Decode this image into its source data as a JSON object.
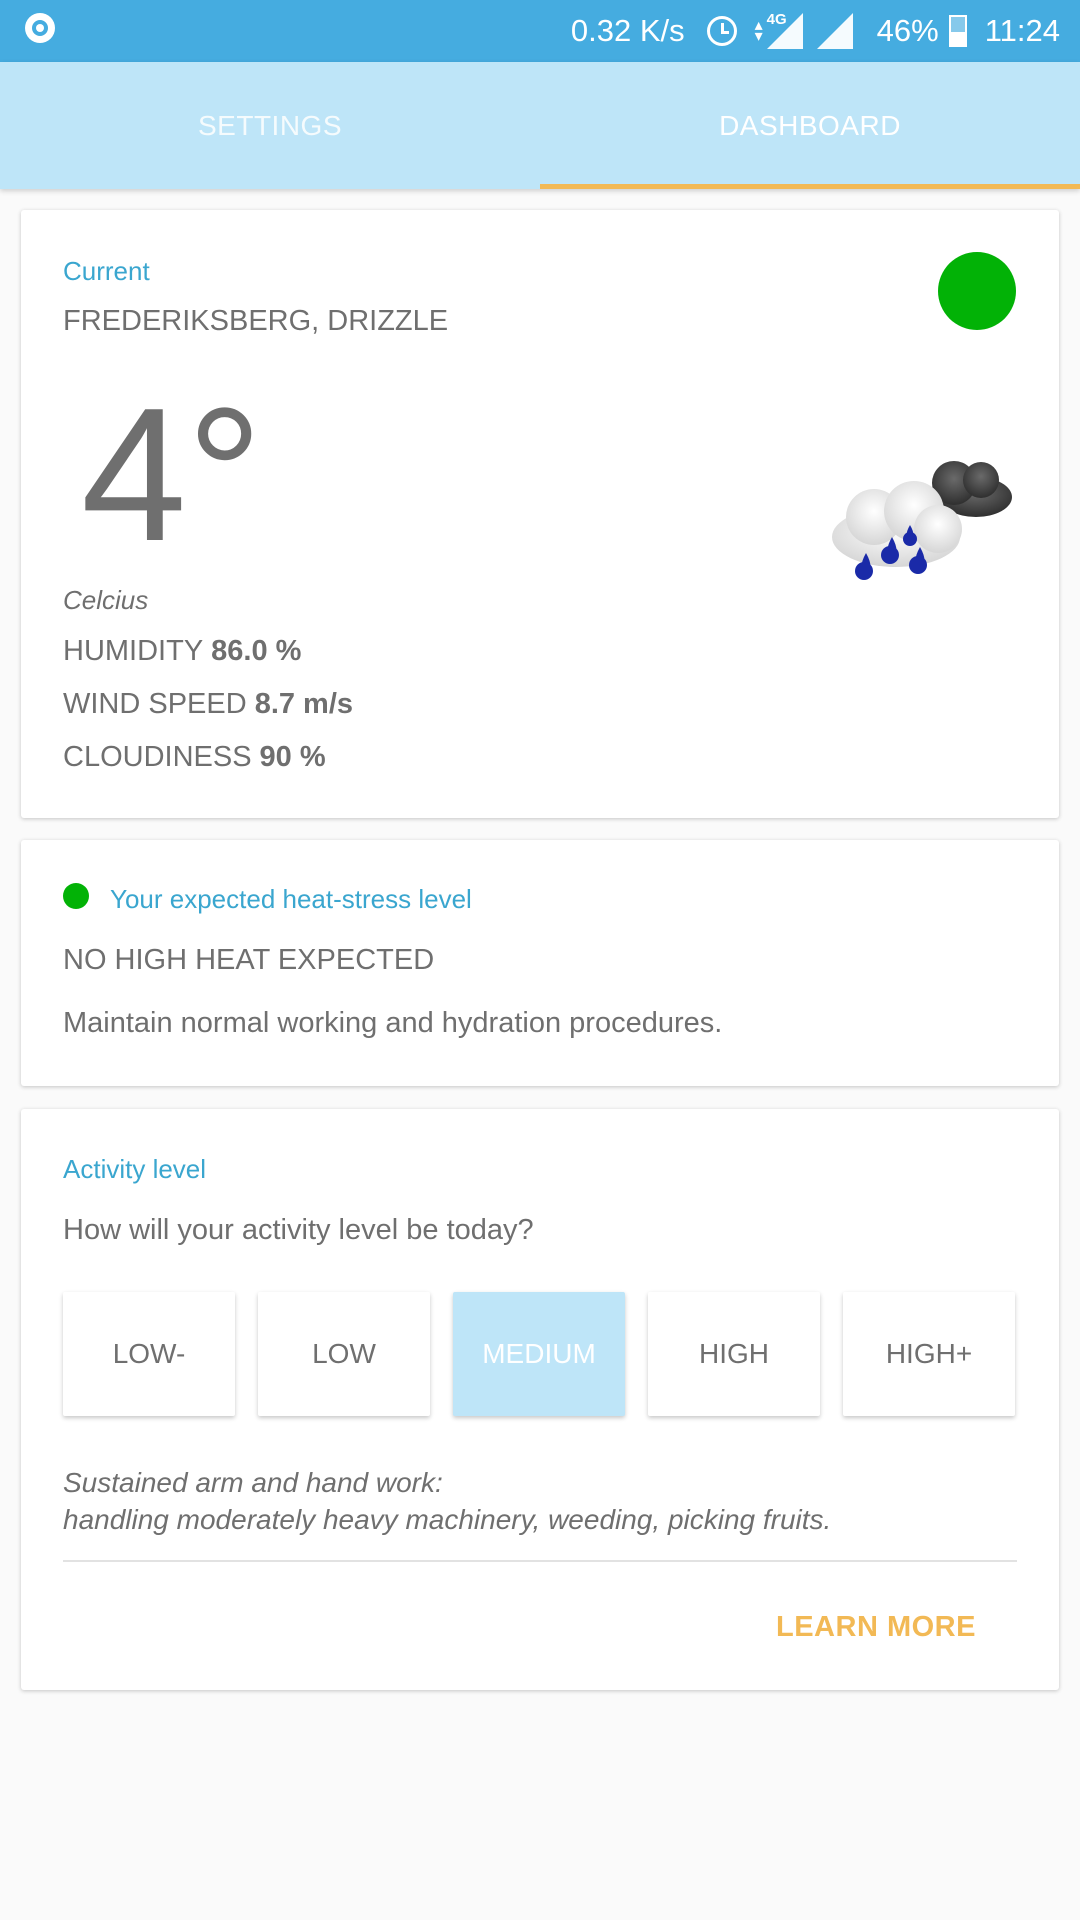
{
  "status_bar": {
    "speed": "0.32 K/s",
    "network_type": "4G",
    "battery": "46%",
    "time": "11:24",
    "icons": [
      "app-notification-icon",
      "alarm-icon",
      "data-arrows-icon",
      "signal-icon",
      "battery-charging-icon"
    ]
  },
  "tabs": [
    {
      "label": "SETTINGS",
      "selected": false
    },
    {
      "label": "DASHBOARD",
      "selected": true
    }
  ],
  "weather": {
    "label": "Current",
    "location": "FREDERIKSBERG, DRIZZLE",
    "temperature": "4°",
    "unit": "Celcius",
    "status_color": "#02b206",
    "icon": "drizzle-cloud-icon",
    "metrics": [
      {
        "label": "HUMIDITY",
        "value": "86.0 %"
      },
      {
        "label": "WIND SPEED",
        "value": "8.7 m/s"
      },
      {
        "label": "CLOUDINESS",
        "value": "90 %"
      }
    ]
  },
  "heat_stress": {
    "label": "Your expected heat-stress level",
    "level": "NO HIGH HEAT EXPECTED",
    "advice": "Maintain normal working and hydration procedures.",
    "indicator_color": "#02b206"
  },
  "activity": {
    "label": "Activity level",
    "question": "How will your activity level be today?",
    "levels": [
      "LOW-",
      "LOW",
      "MEDIUM",
      "HIGH",
      "HIGH+"
    ],
    "selected": "MEDIUM",
    "description_line1": "Sustained arm and hand work:",
    "description_line2": "handling moderately heavy machinery, weeding, picking fruits.",
    "learn_more": "LEARN MORE"
  },
  "colors": {
    "status_bar": "#45ace0",
    "tab_bar": "#bee5f8",
    "accent": "#f2b955",
    "label_blue": "#3aa6cf"
  }
}
